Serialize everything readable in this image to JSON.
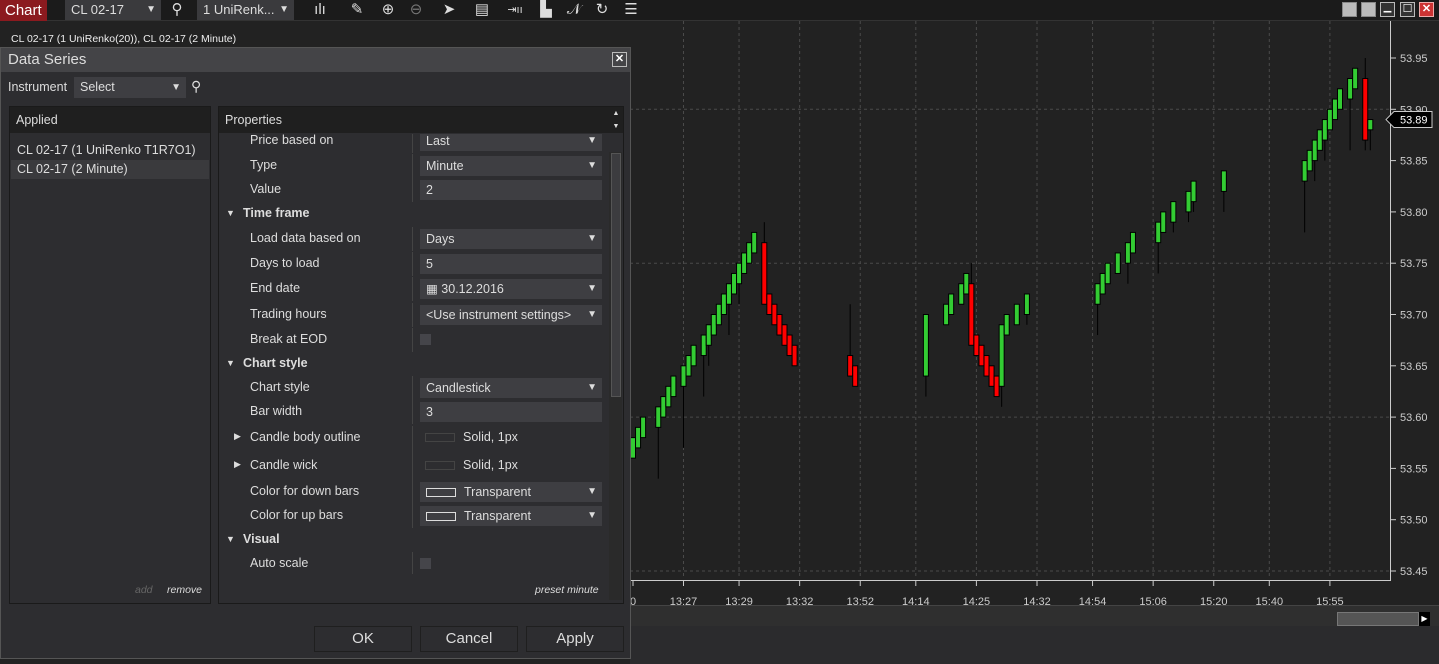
{
  "toolbar": {
    "chart_label": "Chart",
    "instrument": "CL 02-17",
    "series_type": "1 UniRenk...",
    "icons": [
      "bar-type-icon",
      "pencil-icon",
      "zoom-in-icon",
      "zoom-out-icon",
      "pointer-icon",
      "data-box-icon",
      "bar-spacing-icon",
      "templates-icon",
      "drawing-tools-icon",
      "reload-icon",
      "properties-list-icon"
    ]
  },
  "chart": {
    "legend": "CL 02-17 (1 UniRenko(20)), CL 02-17 (2 Minute)",
    "current_price": "53.89",
    "up_color": "#33cc33",
    "down_color": "#ff0000"
  },
  "dialog": {
    "title": "Data Series",
    "instrument_label": "Instrument",
    "instrument_value": "Select",
    "applied_header": "Applied",
    "applied_items": [
      "CL 02-17 (1 UniRenko T1R7O1)",
      "CL 02-17 (2 Minute)"
    ],
    "add_label": "add",
    "remove_label": "remove",
    "properties_header": "Properties",
    "properties": {
      "price_based_on": {
        "label": "Price based on",
        "value": "Last"
      },
      "type": {
        "label": "Type",
        "value": "Minute"
      },
      "value": {
        "label": "Value",
        "value": "2"
      },
      "time_frame": "Time frame",
      "load_data_based_on": {
        "label": "Load data based on",
        "value": "Days"
      },
      "days_to_load": {
        "label": "Days to load",
        "value": "5"
      },
      "end_date": {
        "label": "End date",
        "value": "30.12.2016"
      },
      "trading_hours": {
        "label": "Trading hours",
        "value": "<Use instrument settings>"
      },
      "break_at_eod": {
        "label": "Break at EOD",
        "checked": false
      },
      "chart_style_cat": "Chart style",
      "chart_style": {
        "label": "Chart style",
        "value": "Candlestick"
      },
      "bar_width": {
        "label": "Bar width",
        "value": "3"
      },
      "candle_body_outline": {
        "label": "Candle body outline",
        "value": "Solid, 1px"
      },
      "candle_wick": {
        "label": "Candle wick",
        "value": "Solid, 1px"
      },
      "color_down": {
        "label": "Color for down bars",
        "value": "Transparent"
      },
      "color_up": {
        "label": "Color for up bars",
        "value": "Transparent"
      },
      "visual": "Visual",
      "auto_scale": {
        "label": "Auto scale",
        "checked": false
      }
    },
    "preset_label": "preset minute",
    "ok_label": "OK",
    "cancel_label": "Cancel",
    "apply_label": "Apply"
  },
  "chart_data": {
    "type": "candlestick",
    "ylim": [
      53.44,
      53.96
    ],
    "y_ticks": [
      "53.95",
      "53.90",
      "53.85",
      "53.80",
      "53.75",
      "53.70",
      "53.65",
      "53.60",
      "53.55",
      "53.50",
      "53.45"
    ],
    "y_grid": [
      53.9,
      53.75,
      53.6,
      53.45
    ],
    "x_ticks": [
      {
        "bar": 0,
        "label": "0"
      },
      {
        "bar": 10,
        "label": "13:27"
      },
      {
        "bar": 21,
        "label": "13:29"
      },
      {
        "bar": 33,
        "label": "13:32"
      },
      {
        "bar": 45,
        "label": "13:52"
      },
      {
        "bar": 56,
        "label": "14:14"
      },
      {
        "bar": 68,
        "label": "14:25"
      },
      {
        "bar": 80,
        "label": "14:32"
      },
      {
        "bar": 91,
        "label": "14:54"
      },
      {
        "bar": 103,
        "label": "15:06"
      },
      {
        "bar": 115,
        "label": "15:20"
      },
      {
        "bar": 126,
        "label": "15:40"
      },
      {
        "bar": 138,
        "label": "15:55"
      }
    ],
    "candles": [
      [
        0,
        53.56,
        53.58,
        53.58,
        53.56
      ],
      [
        1,
        53.57,
        53.59,
        53.59,
        53.57
      ],
      [
        2,
        53.58,
        53.6,
        53.6,
        53.58
      ],
      [
        5,
        53.59,
        53.61,
        53.61,
        53.54
      ],
      [
        6,
        53.6,
        53.62,
        53.62,
        53.6
      ],
      [
        7,
        53.61,
        53.63,
        53.63,
        53.61
      ],
      [
        8,
        53.62,
        53.64,
        53.64,
        53.62
      ],
      [
        10,
        53.63,
        53.65,
        53.65,
        53.57
      ],
      [
        11,
        53.64,
        53.66,
        53.66,
        53.64
      ],
      [
        12,
        53.65,
        53.67,
        53.67,
        53.65
      ],
      [
        14,
        53.66,
        53.68,
        53.68,
        53.62
      ],
      [
        15,
        53.67,
        53.69,
        53.69,
        53.65
      ],
      [
        16,
        53.68,
        53.7,
        53.7,
        53.68
      ],
      [
        17,
        53.69,
        53.71,
        53.71,
        53.69
      ],
      [
        18,
        53.7,
        53.72,
        53.72,
        53.7
      ],
      [
        19,
        53.71,
        53.73,
        53.73,
        53.68
      ],
      [
        20,
        53.72,
        53.74,
        53.74,
        53.72
      ],
      [
        21,
        53.73,
        53.75,
        53.75,
        53.71
      ],
      [
        22,
        53.74,
        53.76,
        53.76,
        53.74
      ],
      [
        23,
        53.75,
        53.77,
        53.77,
        53.75
      ],
      [
        24,
        53.76,
        53.78,
        53.78,
        53.76
      ],
      [
        26,
        53.77,
        53.71,
        53.79,
        53.71
      ],
      [
        27,
        53.72,
        53.7,
        53.72,
        53.7
      ],
      [
        28,
        53.71,
        53.69,
        53.71,
        53.69
      ],
      [
        29,
        53.7,
        53.68,
        53.7,
        53.68
      ],
      [
        30,
        53.69,
        53.67,
        53.69,
        53.67
      ],
      [
        31,
        53.68,
        53.66,
        53.68,
        53.66
      ],
      [
        32,
        53.67,
        53.65,
        53.67,
        53.65
      ],
      [
        43,
        53.66,
        53.64,
        53.71,
        53.64
      ],
      [
        44,
        53.65,
        53.63,
        53.65,
        53.63
      ],
      [
        58,
        53.64,
        53.7,
        53.7,
        53.62
      ],
      [
        62,
        53.69,
        53.71,
        53.71,
        53.69
      ],
      [
        63,
        53.7,
        53.72,
        53.72,
        53.7
      ],
      [
        65,
        53.71,
        53.73,
        53.73,
        53.71
      ],
      [
        66,
        53.72,
        53.74,
        53.74,
        53.72
      ],
      [
        67,
        53.73,
        53.67,
        53.75,
        53.67
      ],
      [
        68,
        53.68,
        53.66,
        53.68,
        53.66
      ],
      [
        69,
        53.67,
        53.65,
        53.67,
        53.65
      ],
      [
        70,
        53.66,
        53.64,
        53.66,
        53.64
      ],
      [
        71,
        53.65,
        53.63,
        53.65,
        53.63
      ],
      [
        72,
        53.64,
        53.62,
        53.64,
        53.62
      ],
      [
        73,
        53.63,
        53.69,
        53.69,
        53.61
      ],
      [
        74,
        53.68,
        53.7,
        53.7,
        53.68
      ],
      [
        76,
        53.69,
        53.71,
        53.71,
        53.69
      ],
      [
        78,
        53.7,
        53.72,
        53.72,
        53.69
      ],
      [
        92,
        53.71,
        53.73,
        53.73,
        53.68
      ],
      [
        93,
        53.72,
        53.74,
        53.74,
        53.72
      ],
      [
        94,
        53.73,
        53.75,
        53.75,
        53.73
      ],
      [
        96,
        53.74,
        53.76,
        53.76,
        53.74
      ],
      [
        98,
        53.75,
        53.77,
        53.77,
        53.73
      ],
      [
        99,
        53.76,
        53.78,
        53.78,
        53.76
      ],
      [
        104,
        53.77,
        53.79,
        53.79,
        53.74
      ],
      [
        105,
        53.78,
        53.8,
        53.8,
        53.78
      ],
      [
        107,
        53.79,
        53.81,
        53.81,
        53.78
      ],
      [
        110,
        53.8,
        53.82,
        53.82,
        53.79
      ],
      [
        111,
        53.81,
        53.83,
        53.83,
        53.8
      ],
      [
        117,
        53.82,
        53.84,
        53.84,
        53.8
      ],
      [
        133,
        53.83,
        53.85,
        53.85,
        53.78
      ],
      [
        134,
        53.84,
        53.86,
        53.86,
        53.84
      ],
      [
        135,
        53.85,
        53.87,
        53.87,
        53.83
      ],
      [
        136,
        53.86,
        53.88,
        53.88,
        53.86
      ],
      [
        137,
        53.87,
        53.89,
        53.89,
        53.85
      ],
      [
        138,
        53.88,
        53.9,
        53.9,
        53.88
      ],
      [
        139,
        53.89,
        53.91,
        53.91,
        53.89
      ],
      [
        140,
        53.9,
        53.92,
        53.92,
        53.9
      ],
      [
        142,
        53.91,
        53.93,
        53.93,
        53.86
      ],
      [
        143,
        53.92,
        53.94,
        53.94,
        53.92
      ],
      [
        145,
        53.93,
        53.87,
        53.95,
        53.86
      ],
      [
        146,
        53.88,
        53.89,
        53.89,
        53.86
      ]
    ]
  }
}
